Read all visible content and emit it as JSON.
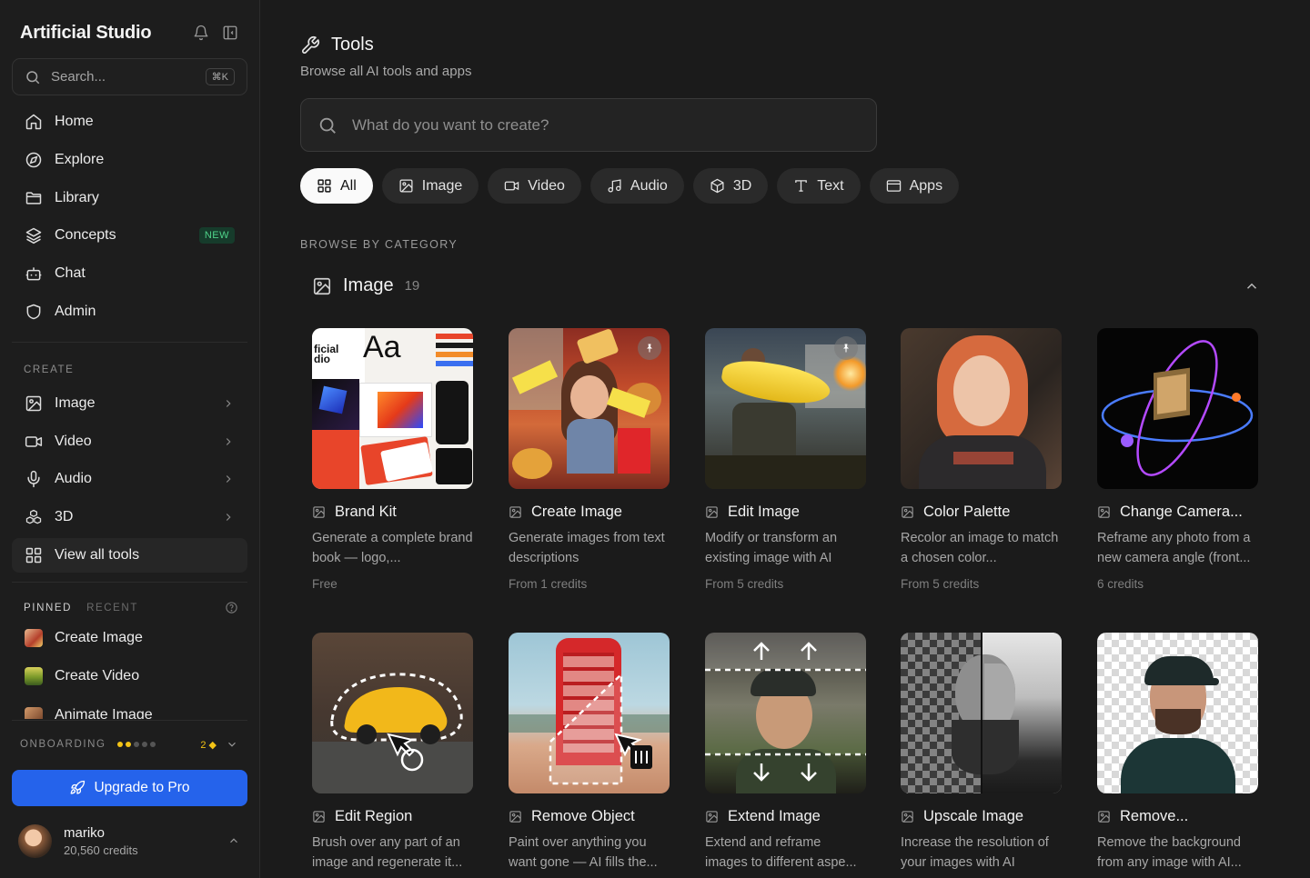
{
  "sidebar": {
    "brand": "Artificial Studio",
    "search": {
      "placeholder": "Search...",
      "shortcut": "⌘K"
    },
    "nav": [
      {
        "label": "Home",
        "icon": "home-icon"
      },
      {
        "label": "Explore",
        "icon": "compass-icon"
      },
      {
        "label": "Library",
        "icon": "folder-icon"
      },
      {
        "label": "Concepts",
        "icon": "layers-icon",
        "badge": "NEW"
      },
      {
        "label": "Chat",
        "icon": "bot-icon"
      },
      {
        "label": "Admin",
        "icon": "shield-icon"
      }
    ],
    "create_label": "CREATE",
    "create": [
      {
        "label": "Image",
        "icon": "image-icon"
      },
      {
        "label": "Video",
        "icon": "video-icon"
      },
      {
        "label": "Audio",
        "icon": "mic-icon"
      },
      {
        "label": "3D",
        "icon": "boxes-icon"
      },
      {
        "label": "View all tools",
        "icon": "grid-icon"
      }
    ],
    "pinned_tab": "PINNED",
    "recent_tab": "RECENT",
    "pinned": [
      {
        "label": "Create Image"
      },
      {
        "label": "Create Video"
      },
      {
        "label": "Animate Image"
      }
    ],
    "onboarding": {
      "label": "ONBOARDING",
      "steps_done": 2,
      "steps_total": 5,
      "count": "2"
    },
    "upgrade": "Upgrade to Pro",
    "user": {
      "name": "mariko",
      "credits": "20,560 credits"
    }
  },
  "main": {
    "title": "Tools",
    "subtitle": "Browse all AI tools and apps",
    "search_placeholder": "What do you want to create?",
    "filters": [
      {
        "label": "All",
        "icon": "grid-icon",
        "active": true
      },
      {
        "label": "Image",
        "icon": "image-icon"
      },
      {
        "label": "Video",
        "icon": "video-icon"
      },
      {
        "label": "Audio",
        "icon": "music-icon"
      },
      {
        "label": "3D",
        "icon": "cube-icon"
      },
      {
        "label": "Text",
        "icon": "type-icon"
      },
      {
        "label": "Apps",
        "icon": "app-window-icon"
      }
    ],
    "browse_label": "BROWSE BY CATEGORY",
    "category": {
      "title": "Image",
      "count": "19"
    },
    "tools": [
      {
        "title": "Brand Kit",
        "desc": "Generate a complete brand book — logo,...",
        "price": "Free"
      },
      {
        "title": "Create Image",
        "desc": "Generate images from text descriptions",
        "price": "From 1 credits"
      },
      {
        "title": "Edit Image",
        "desc": "Modify or transform an existing image with AI",
        "price": "From 5 credits"
      },
      {
        "title": "Color Palette",
        "desc": "Recolor an image to match a chosen color...",
        "price": "From 5 credits"
      },
      {
        "title": "Change Camera...",
        "desc": "Reframe any photo from a new camera angle (front...",
        "price": "6 credits"
      },
      {
        "title": "Edit Region",
        "desc": "Brush over any part of an image and regenerate it...",
        "price": ""
      },
      {
        "title": "Remove Object",
        "desc": "Paint over anything you want gone — AI fills the...",
        "price": ""
      },
      {
        "title": "Extend Image",
        "desc": "Extend and reframe images to different aspe...",
        "price": ""
      },
      {
        "title": "Upscale Image",
        "desc": "Increase the resolution of your images with AI",
        "price": ""
      },
      {
        "title": "Remove...",
        "desc": "Remove the background from any image with AI...",
        "price": ""
      }
    ]
  },
  "colors": {
    "accent": "#2563eb",
    "new_badge": "#4fd389",
    "onboarding": "#f3c316",
    "background": "#1b1b1b"
  }
}
